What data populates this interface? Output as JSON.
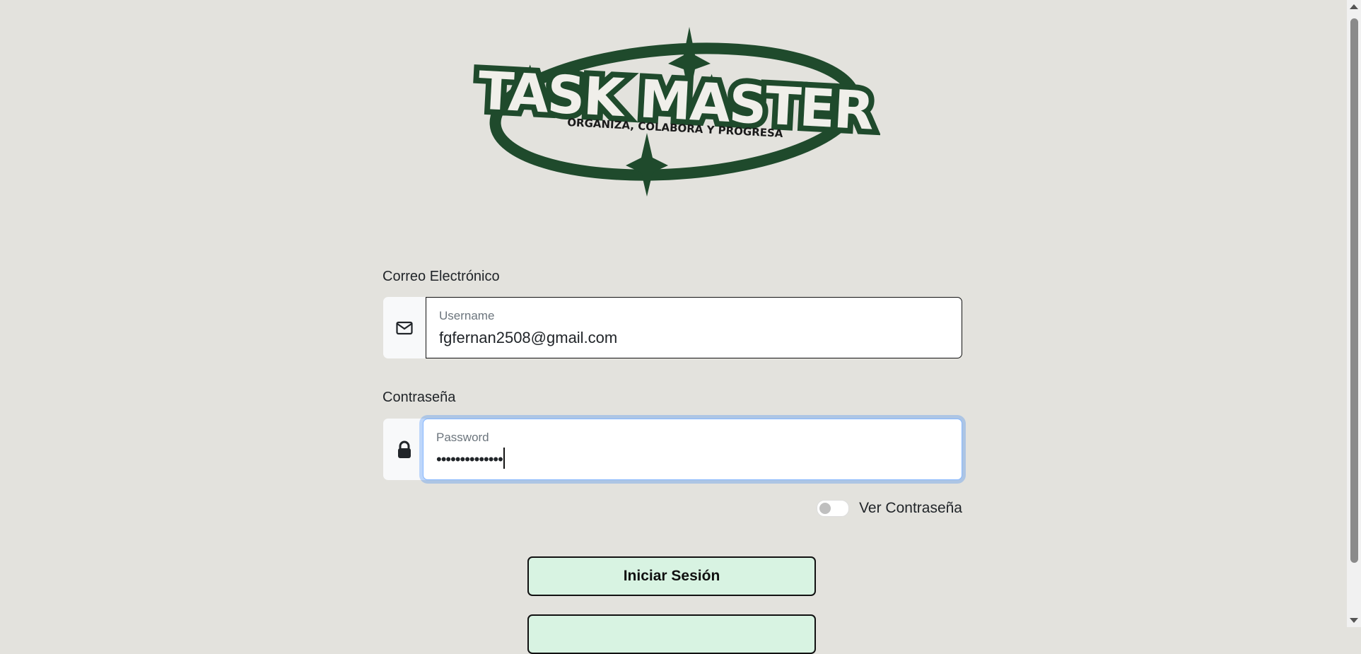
{
  "logo": {
    "title": "TASK MASTER",
    "tagline": "ORGANIZA, COLABORA Y PROGRESA",
    "color": "#1f4a2c"
  },
  "form": {
    "email_label": "Correo Electrónico",
    "email_placeholder": "Username",
    "email_value": "fgfernan2508@gmail.com",
    "email_icon": "envelope-icon",
    "password_label": "Contraseña",
    "password_placeholder": "Password",
    "password_value": "••••••••••••••",
    "password_icon": "lock-icon",
    "show_password_label": "Ver Contraseña",
    "show_password_checked": false
  },
  "buttons": {
    "login": "Iniciar Sesión",
    "second": ""
  },
  "colors": {
    "background": "#e3e2dd",
    "button": "#d8f3e2",
    "focus": "#86b7fe"
  }
}
